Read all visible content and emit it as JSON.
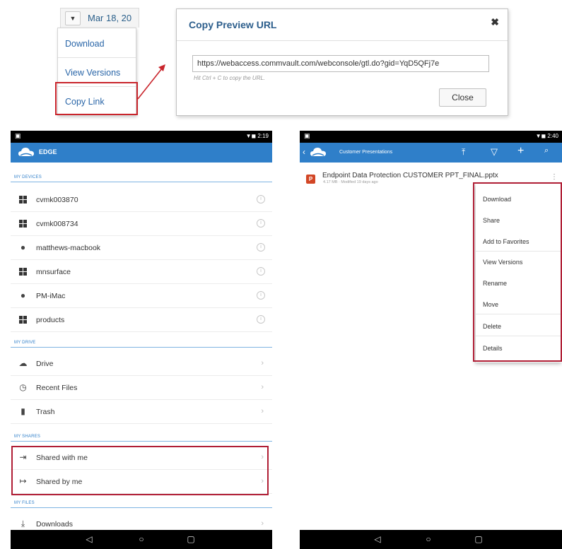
{
  "dropdown": {
    "date": "Mar 18, 20",
    "arrow_glyph": "▼",
    "items": [
      {
        "label": "Download"
      },
      {
        "label": "View Versions"
      },
      {
        "label": "Copy Link"
      }
    ]
  },
  "dialog": {
    "title": "Copy Preview URL",
    "close_glyph": "✖",
    "url_value": "https://webaccess.commvault.com/webconsole/gtl.do?gid=YqD5QFj7e",
    "hint": "Hit Ctrl + C to copy the URL.",
    "close_label": "Close"
  },
  "left_phone": {
    "status_right": "▼◼ 2:19",
    "app_title": "EDGE",
    "sections": {
      "devices": "MY DEVICES",
      "drive": "MY DRIVE",
      "shares": "MY SHARES",
      "files": "MY FILES"
    },
    "devices": [
      {
        "label": "cvmk003870",
        "icon": "windows-icon"
      },
      {
        "label": "cvmk008734",
        "icon": "windows-icon"
      },
      {
        "label": "matthews-macbook",
        "icon": "apple-icon"
      },
      {
        "label": "mnsurface",
        "icon": "windows-icon"
      },
      {
        "label": "PM-iMac",
        "icon": "apple-icon"
      },
      {
        "label": "products",
        "icon": "windows-icon"
      }
    ],
    "drive": [
      {
        "label": "Drive",
        "icon": "cloud-icon"
      },
      {
        "label": "Recent Files",
        "icon": "clock-icon"
      },
      {
        "label": "Trash",
        "icon": "trash-icon"
      }
    ],
    "shares": [
      {
        "label": "Shared with me",
        "icon": "share-in-icon"
      },
      {
        "label": "Shared by me",
        "icon": "share-out-icon"
      }
    ],
    "files": [
      {
        "label": "Downloads",
        "icon": "download-icon"
      }
    ]
  },
  "right_phone": {
    "status_right": "▼◼ 2:40",
    "app_title": "Customer Presentations",
    "file": {
      "name": "Endpoint Data Protection CUSTOMER PPT_FINAL.pptx",
      "meta": "4.17 MB · Modified 19 days ago",
      "badge": "P"
    },
    "context_menu": [
      {
        "label": "Download"
      },
      {
        "label": "Share"
      },
      {
        "label": "Add to Favorites"
      },
      {
        "label": "View Versions"
      },
      {
        "label": "Rename"
      },
      {
        "label": "Move"
      },
      {
        "label": "Delete"
      },
      {
        "label": "Details"
      }
    ]
  },
  "colors": {
    "appbar": "#2f7fc9",
    "highlight": "#b01e35",
    "link": "#2a66a8"
  }
}
